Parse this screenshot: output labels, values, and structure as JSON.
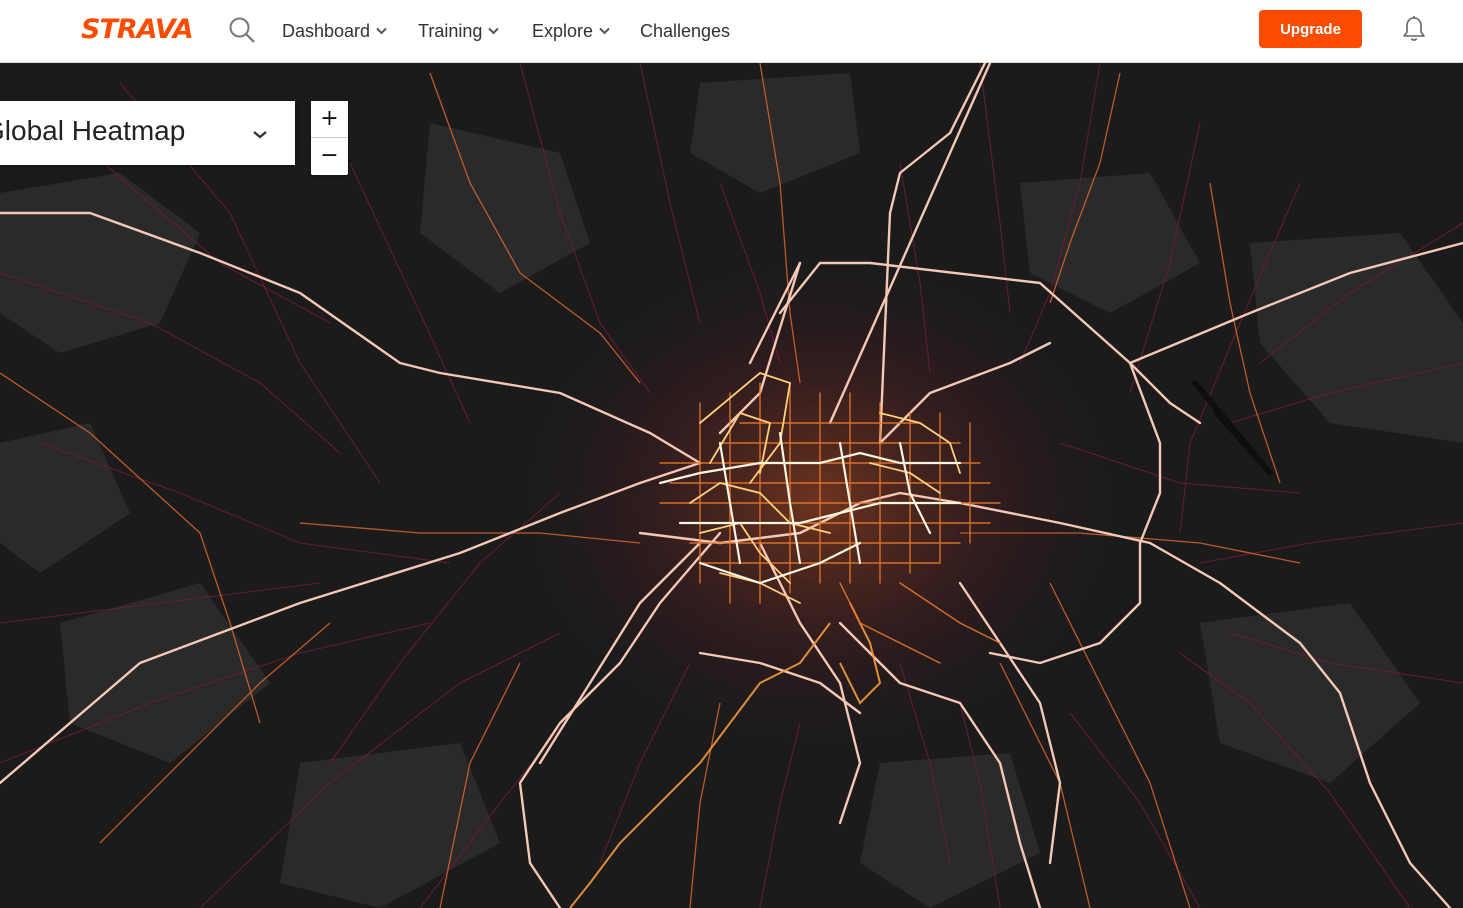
{
  "header": {
    "logo_text": "STRAVA",
    "search_icon": "search-icon",
    "nav": [
      {
        "label": "Dashboard",
        "dropdown": true
      },
      {
        "label": "Training",
        "dropdown": true
      },
      {
        "label": "Explore",
        "dropdown": true
      },
      {
        "label": "Challenges",
        "dropdown": false
      }
    ],
    "upgrade_label": "Upgrade",
    "notifications_icon": "bell-icon"
  },
  "map": {
    "map_type_label": "Global Heatmap",
    "map_type_icon": "chevron-down-icon",
    "zoom_in_label": "+",
    "zoom_out_label": "−"
  },
  "colors": {
    "brand": "#fc4c02",
    "map_background": "#1b1b1b",
    "heat_low": "#7a1a3a",
    "heat_mid": "#e8772a",
    "heat_high": "#fff2d4"
  }
}
